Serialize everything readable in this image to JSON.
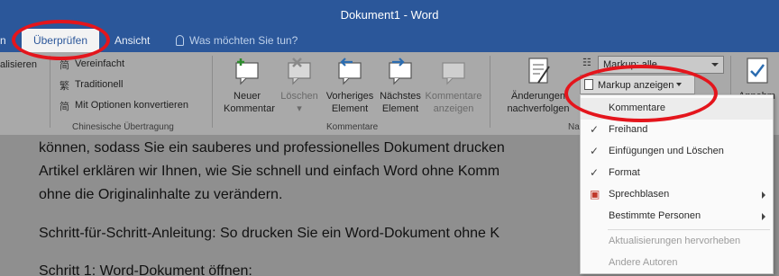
{
  "window": {
    "title": "Dokument1 - Word"
  },
  "tabs": {
    "left_cut": "n",
    "active": "Überprüfen",
    "ansicht": "Ansicht",
    "search_placeholder": "Was möchten Sie tun?"
  },
  "ribbon": {
    "left_cut_text": "alisieren",
    "chinese": {
      "items": [
        "Vereinfacht",
        "Traditionell",
        "Mit Optionen konvertieren"
      ],
      "group_label": "Chinesische Übertragung"
    },
    "comments": {
      "buttons": [
        {
          "line1": "Neuer",
          "line2": "Kommentar"
        },
        {
          "line1": "Löschen",
          "line2": ""
        },
        {
          "line1": "Vorheriges",
          "line2": "Element"
        },
        {
          "line1": "Nächstes",
          "line2": "Element"
        },
        {
          "line1": "Kommentare",
          "line2": "anzeigen"
        }
      ],
      "group_label": "Kommentare"
    },
    "tracking": {
      "changes_line1": "Änderungen",
      "changes_line2": "nachverfolgen",
      "group_label_cut": "Na",
      "markup_select": "Markup: alle",
      "markup_button": "Markup anzeigen",
      "right_cut": "Annehm"
    }
  },
  "menu": {
    "items": [
      {
        "label": "Kommentare",
        "checked": false,
        "submenu": false,
        "disabled": false
      },
      {
        "label": "Freihand",
        "checked": true,
        "submenu": false,
        "disabled": false
      },
      {
        "label": "Einfügungen und Löschen",
        "checked": true,
        "submenu": false,
        "disabled": false
      },
      {
        "label": "Format",
        "checked": true,
        "submenu": false,
        "disabled": false
      },
      {
        "label": "Sprechblasen",
        "checked": false,
        "submenu": true,
        "disabled": false
      },
      {
        "label": "Bestimmte Personen",
        "checked": false,
        "submenu": true,
        "disabled": false
      },
      {
        "label": "Aktualisierungen hervorheben",
        "checked": false,
        "submenu": false,
        "disabled": true
      },
      {
        "label": "Andere Autoren",
        "checked": false,
        "submenu": false,
        "disabled": true
      }
    ]
  },
  "document": {
    "lines": [
      "können, sodass Sie ein sauberes und professionelles Dokument drucken",
      "Artikel erklären wir Ihnen, wie Sie schnell und einfach Word ohne Komm",
      "ohne die Originalinhalte zu verändern.",
      "Schritt-für-Schritt-Anleitung: So drucken Sie ein Word-Dokument ohne K",
      "Schritt 1: Word-Dokument öffnen:"
    ]
  },
  "colors": {
    "accent": "#2b579a",
    "highlight_ring": "#e4151c"
  }
}
